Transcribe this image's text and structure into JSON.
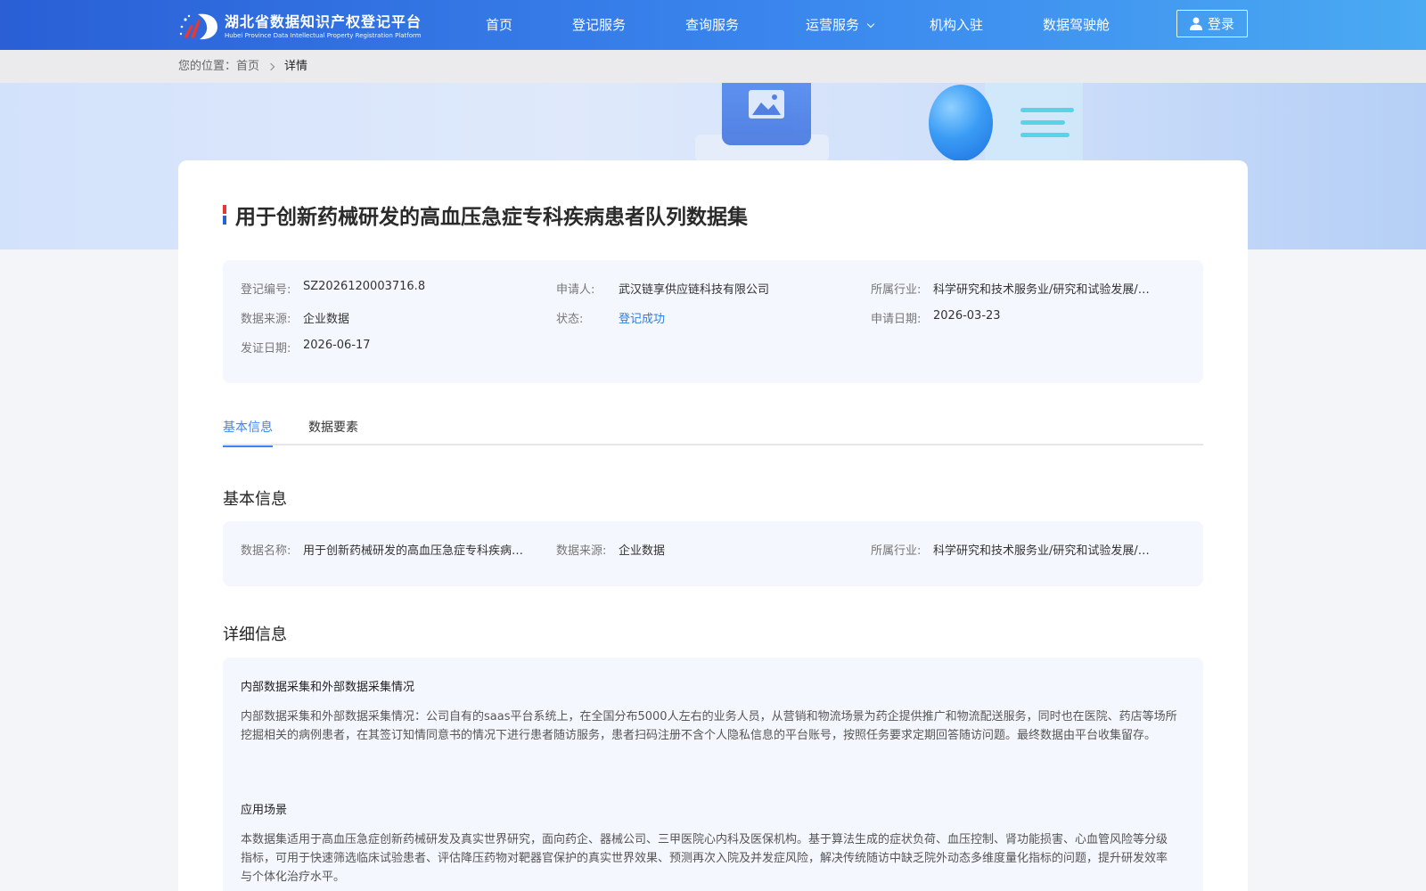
{
  "header": {
    "logo_title": "湖北省数据知识产权登记平台",
    "logo_subtitle": "Hubei Province Data Intellectual Property Registration Platform",
    "nav": [
      "首页",
      "登记服务",
      "查询服务",
      "运营服务",
      "机构入驻",
      "数据驾驶舱"
    ],
    "login_label": "登录"
  },
  "breadcrumb": {
    "prefix": "您的位置：",
    "home": "首页",
    "current": "详情"
  },
  "page": {
    "title": "用于创新药械研发的高血压急症专科疾病患者队列数据集"
  },
  "summary": {
    "reg_no_label": "登记编号:",
    "reg_no": "SZ2026120003716.8",
    "applicant_label": "申请人:",
    "applicant": "武汉链享供应链科技有限公司",
    "industry_label": "所属行业:",
    "industry": "科学研究和技术服务业/研究和试验发展/…",
    "source_label": "数据来源:",
    "source": "企业数据",
    "status_label": "状态:",
    "status": "登记成功",
    "apply_date_label": "申请日期:",
    "apply_date": "2026-03-23",
    "issue_date_label": "发证日期:",
    "issue_date": "2026-06-17"
  },
  "tabs": [
    "基本信息",
    "数据要素"
  ],
  "basic": {
    "section_title": "基本信息",
    "name_label": "数据名称:",
    "name": "用于创新药械研发的高血压急症专科疾病…",
    "source_label": "数据来源:",
    "source": "企业数据",
    "industry_label": "所属行业:",
    "industry": "科学研究和技术服务业/研究和试验发展/…"
  },
  "detail": {
    "section_title": "详细信息",
    "collect_title": "内部数据采集和外部数据采集情况",
    "collect_text": "内部数据采集和外部数据采集情况：公司自有的saas平台系统上，在全国分布5000人左右的业务人员，从营销和物流场景为药企提供推广和物流配送服务，同时也在医院、药店等场所挖掘相关的病例患者，在其签订知情同意书的情况下进行患者随访服务，患者扫码注册不含个人隐私信息的平台账号，按照任务要求定期回答随访问题。最终数据由平台收集留存。",
    "scene_title": "应用场景",
    "scene_text": "本数据集适用于高血压急症创新药械研发及真实世界研究，面向药企、器械公司、三甲医院心内科及医保机构。基于算法生成的症状负荷、血压控制、肾功能损害、心血管风险等分级指标，可用于快速筛选临床试验患者、评估降压药物对靶器官保护的真实世界效果、预测再次入院及并发症风险，解决传统随访中缺乏院外动态多维度量化指标的问题，提升研发效率与个体化治疗水平。"
  },
  "colors": {
    "header_start": "#2a5fd6",
    "header_end": "#4aaaf2",
    "accent": "#3c86ee",
    "success": "#2f7de1"
  }
}
